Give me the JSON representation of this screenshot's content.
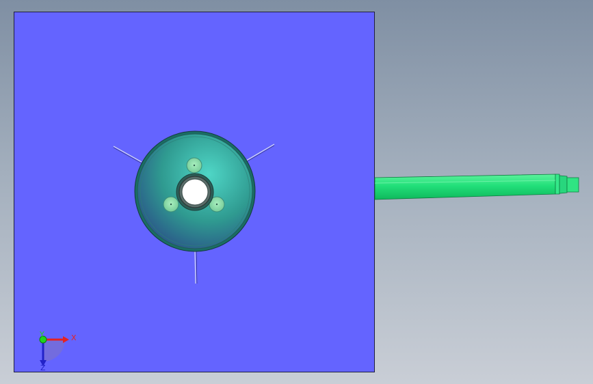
{
  "viewport": {
    "background_top": "#7f8fa3",
    "background_bottom": "#c9ced6",
    "plane_color": "#6464ff",
    "plane_border": "#1e1e3c"
  },
  "model": {
    "vessel_color": "#3aa79a",
    "nozzle_color": "#8fd6a6",
    "pipe_color": "#22e07a",
    "opening_color": "#ffffff"
  },
  "triad": {
    "x_label": "X",
    "y_label": "Y",
    "z_label": "Z",
    "x_color": "#e52222",
    "y_color": "#1fd41f",
    "z_color": "#2222c8"
  }
}
